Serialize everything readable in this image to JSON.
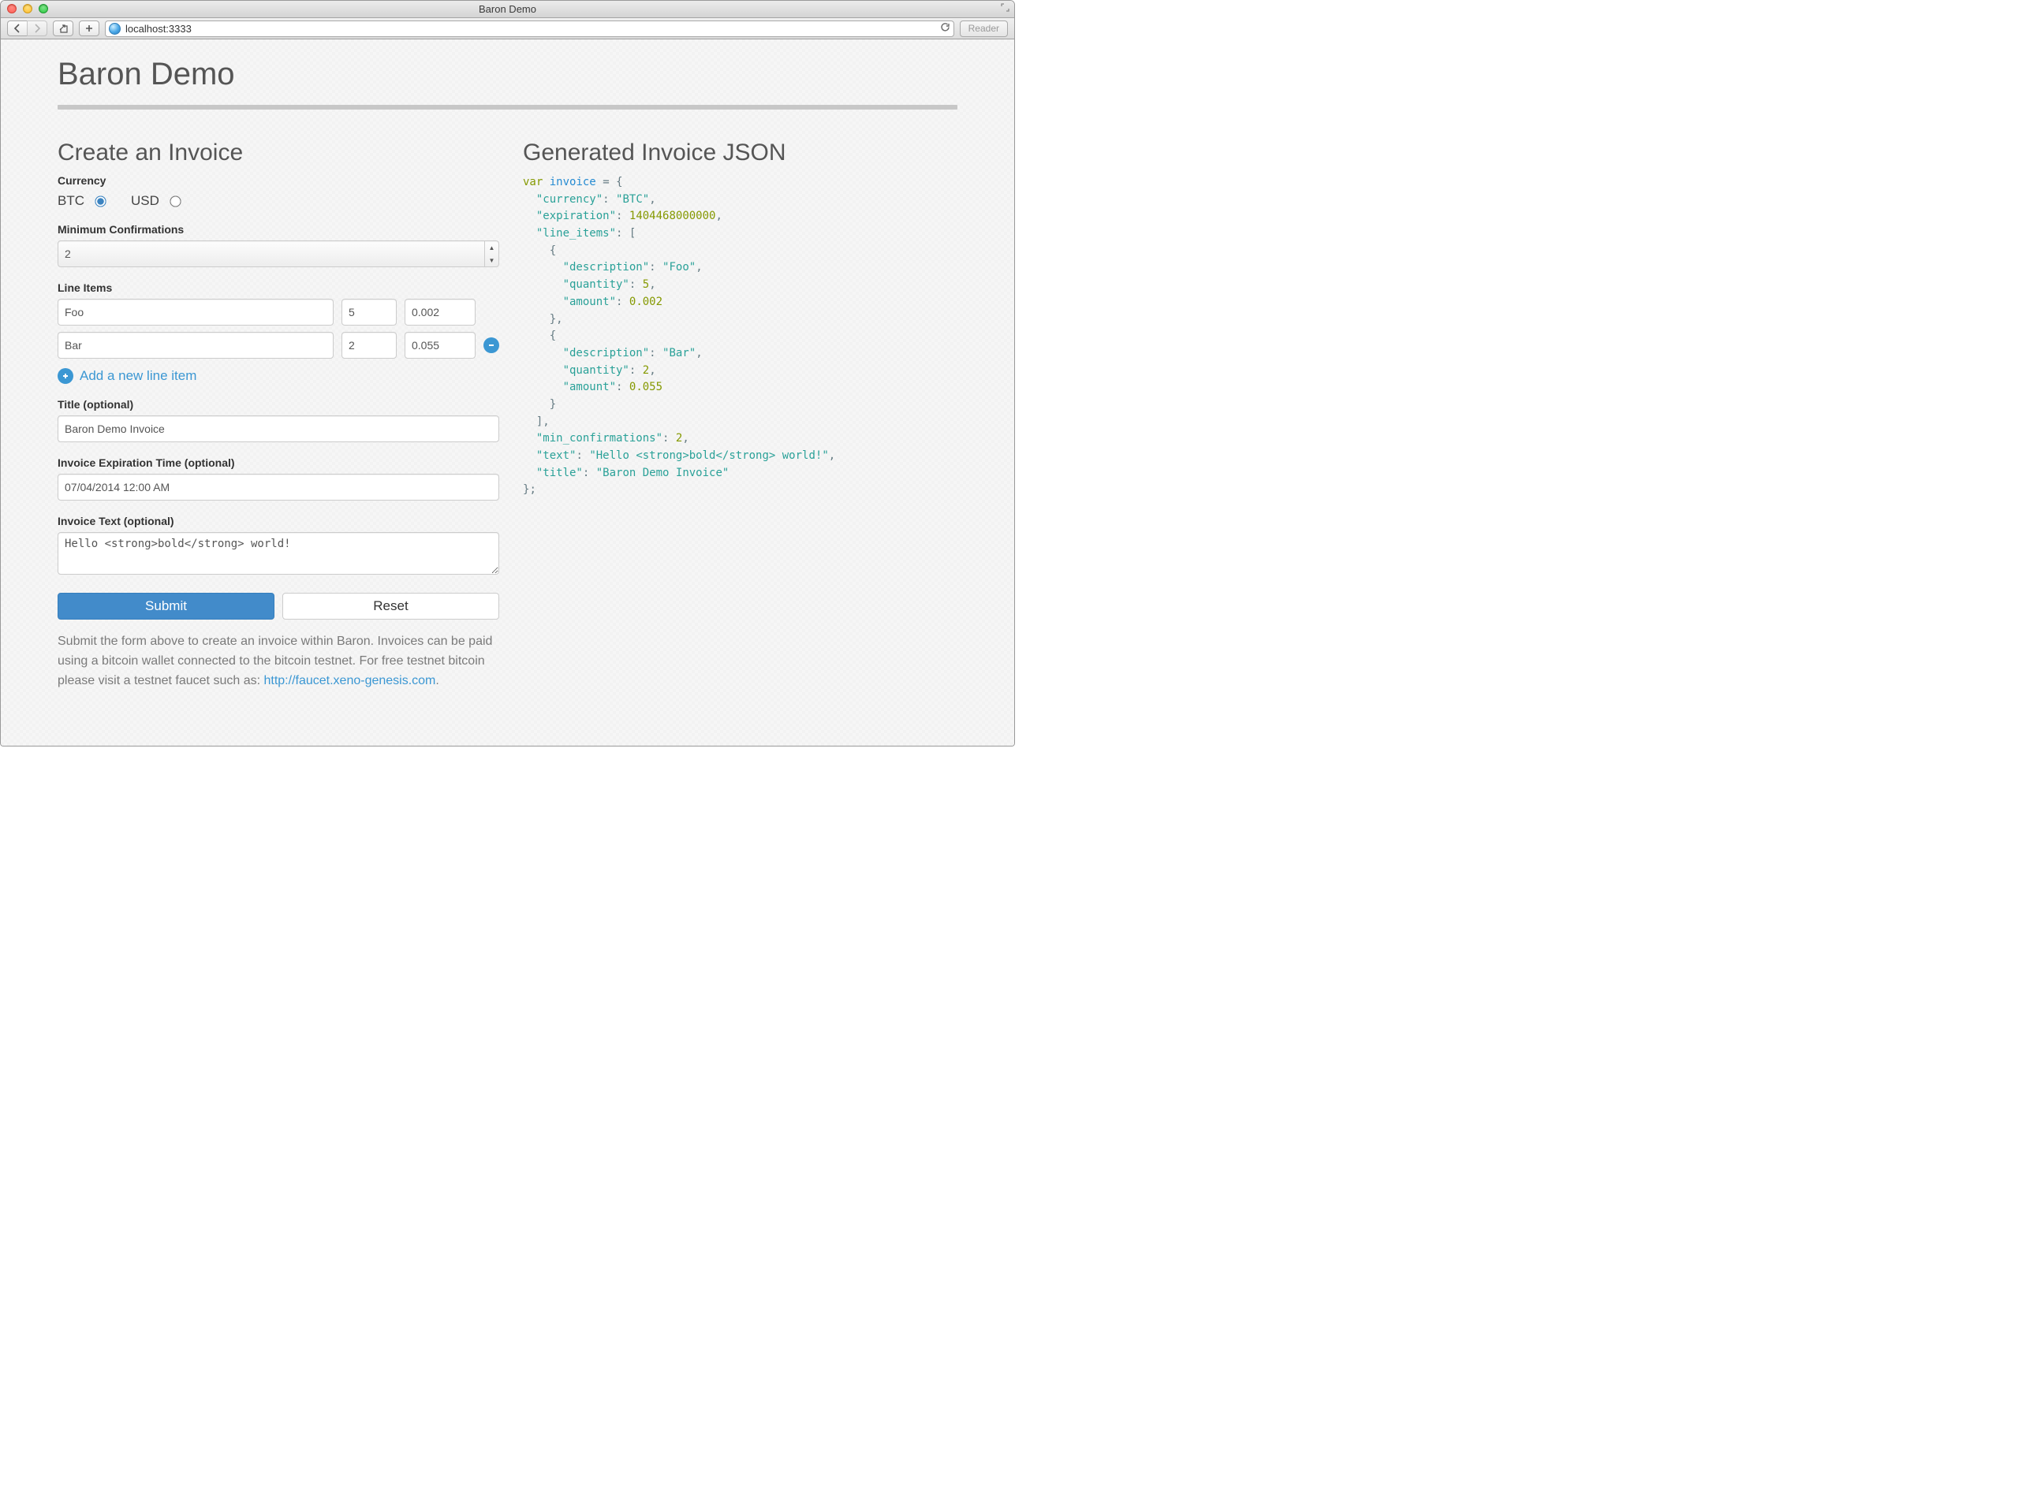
{
  "window": {
    "title": "Baron Demo",
    "url": "localhost:3333",
    "reader_label": "Reader"
  },
  "page": {
    "title": "Baron Demo"
  },
  "form": {
    "heading": "Create an Invoice",
    "currency_label": "Currency",
    "currency_options": {
      "btc": "BTC",
      "usd": "USD"
    },
    "currency_selected": "BTC",
    "min_conf_label": "Minimum Confirmations",
    "min_conf_value": "2",
    "line_items_label": "Line Items",
    "line_items": [
      {
        "description": "Foo",
        "quantity": "5",
        "amount": "0.002"
      },
      {
        "description": "Bar",
        "quantity": "2",
        "amount": "0.055"
      }
    ],
    "add_line_label": "Add a new line item",
    "title_label": "Title (optional)",
    "title_value": "Baron Demo Invoice",
    "exp_label": "Invoice Expiration Time (optional)",
    "exp_value": "07/04/2014 12:00 AM",
    "text_label": "Invoice Text (optional)",
    "text_value": "Hello <strong>bold</strong> world!",
    "submit_label": "Submit",
    "reset_label": "Reset",
    "help_text": "Submit the form above to create an invoice within Baron. Invoices can be paid using a bitcoin wallet connected to the bitcoin testnet. For free testnet bitcoin please visit a testnet faucet such as: ",
    "help_link_text": "http://faucet.xeno-genesis.com",
    "help_link_suffix": "."
  },
  "json_panel": {
    "heading": "Generated Invoice JSON",
    "code": {
      "var_kw": "var",
      "ident": "invoice",
      "currency_key": "\"currency\"",
      "currency_val": "\"BTC\"",
      "expiration_key": "\"expiration\"",
      "expiration_val": "1404468000000",
      "line_items_key": "\"line_items\"",
      "desc_key": "\"description\"",
      "qty_key": "\"quantity\"",
      "amt_key": "\"amount\"",
      "item0_desc": "\"Foo\"",
      "item0_qty": "5",
      "item0_amt": "0.002",
      "item1_desc": "\"Bar\"",
      "item1_qty": "2",
      "item1_amt": "0.055",
      "minconf_key": "\"min_confirmations\"",
      "minconf_val": "2",
      "text_key": "\"text\"",
      "text_val": "\"Hello <strong>bold</strong> world!\"",
      "title_key": "\"title\"",
      "title_val": "\"Baron Demo Invoice\""
    }
  }
}
